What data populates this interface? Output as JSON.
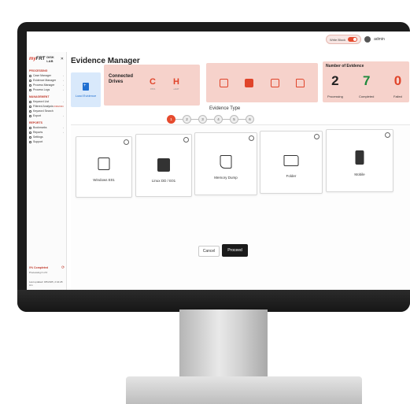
{
  "app": {
    "title": "Evidence Manager",
    "logo": {
      "mark_prefix": "my",
      "mark_suffix": "FRT",
      "lab_name": "DISK LAB",
      "close_glyph": "✕"
    }
  },
  "topbar": {
    "write_block_label": "Write Block",
    "write_block_on": true,
    "user_name": "admin"
  },
  "sidebar": {
    "sections": [
      {
        "title": "PROCESSING",
        "items": [
          {
            "label": "Case Manager",
            "chevron": "›",
            "icon": "briefcase-icon"
          },
          {
            "label": "Evidence Manager",
            "chevron": "›",
            "icon": "evidence-icon"
          },
          {
            "label": "Process Manager",
            "chevron": "›",
            "icon": "process-icon"
          },
          {
            "label": "Process Logs",
            "chevron": "›",
            "icon": "logs-icon"
          }
        ]
      },
      {
        "title": "MANAGEMENT",
        "items": [
          {
            "label": "Keyword List",
            "chevron": "›",
            "icon": "list-icon"
          },
          {
            "label": "Filtered Analysis",
            "badge": "FORENSIC",
            "icon": "filter-icon"
          },
          {
            "label": "Keyword Search",
            "chevron": "",
            "icon": "search-icon"
          },
          {
            "label": "Export",
            "chevron": "›",
            "icon": "export-icon"
          }
        ]
      },
      {
        "title": "REPORTS",
        "items": [
          {
            "label": "Bookmarks",
            "chevron": "›",
            "icon": "bookmark-icon"
          },
          {
            "label": "Reports",
            "chevron": "›",
            "icon": "report-icon"
          },
          {
            "label": "Settings",
            "chevron": "",
            "icon": "settings-icon"
          },
          {
            "label": "Support",
            "chevron": "",
            "icon": "support-icon"
          }
        ]
      }
    ],
    "status": "0% Completed",
    "status_sub": "Processing 0 of 0",
    "updated": "Last updated: 9/5/2025, 2:44:28 Am"
  },
  "load_evidence": {
    "label": "Load Evidence"
  },
  "connected_drives": {
    "title": "Connected Drives",
    "drives": [
      {
        "letter": "C",
        "fs": "NTFS"
      },
      {
        "letter": "H",
        "fs": "exFAT"
      }
    ]
  },
  "tools": [
    "email-evidence-icon",
    "save-icon",
    "memory-card-icon",
    "folder-icon"
  ],
  "evidence_counts": {
    "title": "Number of Evidence",
    "processing": {
      "value": "2",
      "label": "Processing",
      "color": "#222222"
    },
    "completed": {
      "value": "7",
      "label": "Completed",
      "color": "#1e8a3c"
    },
    "failed": {
      "value": "0",
      "label": "Failed",
      "color": "#e0442a"
    }
  },
  "evidence_type": {
    "title": "Evidence Type",
    "steps": [
      "1",
      "2",
      "3",
      "4",
      "5",
      "6"
    ],
    "active_step": "1",
    "options": [
      {
        "label": "Windows E01",
        "icon": "inbox-icon"
      },
      {
        "label": "Linux DD / E01",
        "icon": "disk-icon"
      },
      {
        "label": "Memory Dump",
        "icon": "memory-icon"
      },
      {
        "label": "Folder",
        "icon": "folder-icon"
      },
      {
        "label": "Mobile",
        "icon": "mobile-icon"
      }
    ]
  },
  "actions": {
    "cancel_label": "Cancel",
    "proceed_label": "Proceed"
  },
  "colors": {
    "accent": "#e64b2e",
    "card_bg": "#f6d2cb",
    "load_bg": "#d9e9fb",
    "dark": "#1b1b1b"
  }
}
